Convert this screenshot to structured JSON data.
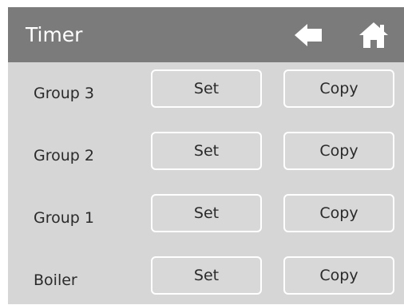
{
  "header": {
    "title": "Timer",
    "back_icon": "back-arrow-icon",
    "home_icon": "home-icon"
  },
  "rows": [
    {
      "label": "Group 3",
      "set_label": "Set",
      "copy_label": "Copy"
    },
    {
      "label": "Group 2",
      "set_label": "Set",
      "copy_label": "Copy"
    },
    {
      "label": "Group 1",
      "set_label": "Set",
      "copy_label": "Copy"
    },
    {
      "label": "Boiler",
      "set_label": "Set",
      "copy_label": "Copy"
    }
  ],
  "colors": {
    "header_bg": "#7b7b7b",
    "screen_bg": "#d6d6d6",
    "text": "#2a2a2a",
    "icon": "#ffffff"
  }
}
